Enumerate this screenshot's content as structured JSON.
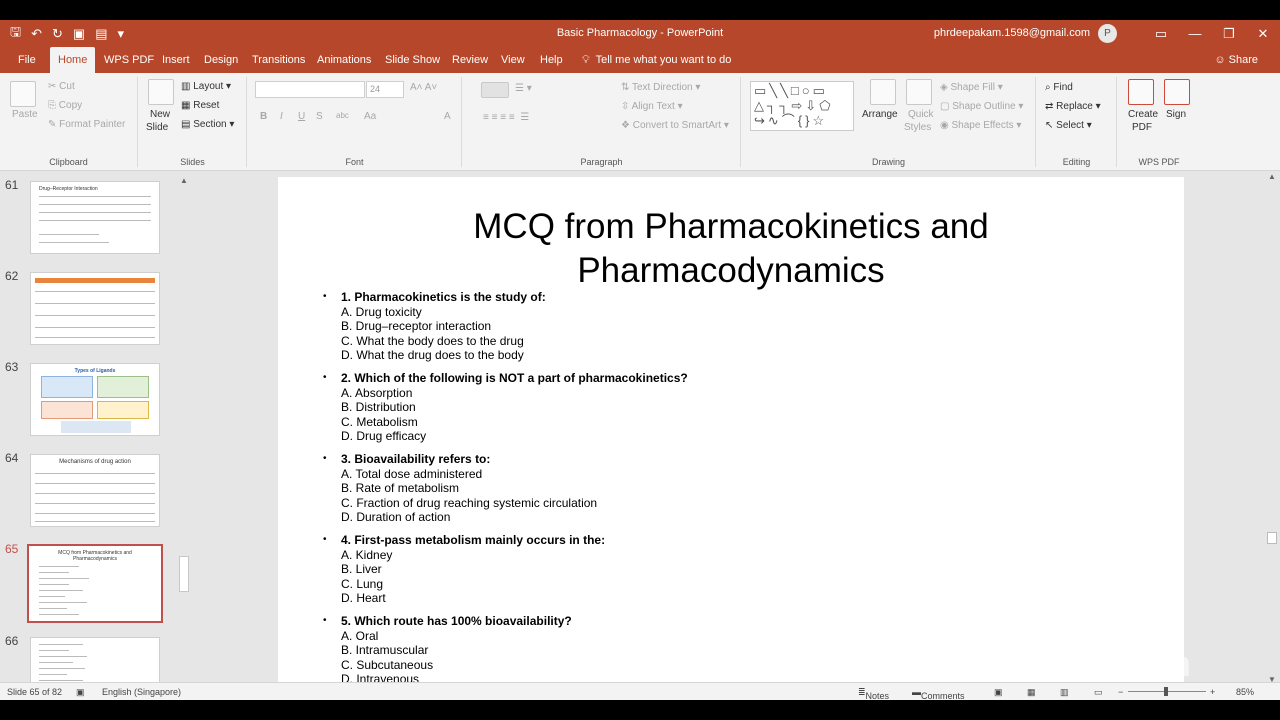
{
  "window": {
    "title": "Basic Pharmacology - PowerPoint",
    "account": "phrdeepakam.1598@gmail.com",
    "avatar_letter": "P"
  },
  "tabs": [
    "File",
    "Home",
    "WPS PDF",
    "Insert",
    "Design",
    "Transitions",
    "Animations",
    "Slide Show",
    "Review",
    "View",
    "Help"
  ],
  "tellme": "Tell me what you want to do",
  "share": "Share",
  "ribbon": {
    "clipboard": {
      "paste": "Paste",
      "cut": "Cut",
      "copy": "Copy",
      "format_painter": "Format Painter",
      "label": "Clipboard"
    },
    "slides": {
      "new_slide_1": "New",
      "new_slide_2": "Slide",
      "layout": "Layout",
      "reset": "Reset",
      "section": "Section",
      "label": "Slides"
    },
    "font": {
      "size": "24",
      "bold": "B",
      "italic": "I",
      "underline": "U",
      "strike": "S",
      "spacing": "abc",
      "case": "Aa",
      "label": "Font"
    },
    "paragraph": {
      "text_direction": "Text Direction",
      "align_text": "Align Text",
      "smartart": "Convert to SmartArt",
      "label": "Paragraph"
    },
    "drawing": {
      "arrange": "Arrange",
      "quick_styles_1": "Quick",
      "quick_styles_2": "Styles",
      "shape_fill": "Shape Fill",
      "shape_outline": "Shape Outline",
      "shape_effects": "Shape Effects",
      "label": "Drawing"
    },
    "editing": {
      "find": "Find",
      "replace": "Replace",
      "select": "Select",
      "label": "Editing"
    },
    "wps": {
      "create_1": "Create",
      "create_2": "PDF",
      "sign": "Sign",
      "label": "WPS PDF"
    }
  },
  "thumbnails": [
    {
      "num": "61",
      "title": "Drug–Receptor Interaction"
    },
    {
      "num": "62",
      "title": ""
    },
    {
      "num": "63",
      "title": "Types of Ligands"
    },
    {
      "num": "64",
      "title": "Mechanisms of drug action"
    },
    {
      "num": "65",
      "title": "MCQ from Pharmacokinetics and Pharmacodynamics"
    },
    {
      "num": "66",
      "title": ""
    }
  ],
  "slide": {
    "title": "MCQ from Pharmacokinetics and Pharmacodynamics",
    "questions": [
      {
        "q": "1. Pharmacokinetics is the study of:",
        "options": [
          "A. Drug toxicity",
          "B. Drug–receptor interaction",
          "C. What the body does to the drug",
          "D. What the drug does to the body"
        ]
      },
      {
        "q": "2. Which of the following is NOT a part of pharmacokinetics?",
        "options": [
          "A. Absorption",
          "B. Distribution",
          "C. Metabolism",
          "D. Drug efficacy"
        ]
      },
      {
        "q": "3. Bioavailability refers to:",
        "options": [
          "A. Total dose administered",
          "B. Rate of metabolism",
          "C. Fraction of drug reaching systemic circulation",
          "D. Duration of action"
        ]
      },
      {
        "q": "4. First-pass metabolism mainly occurs in the:",
        "options": [
          "A. Kidney",
          "B. Liver",
          "C. Lung",
          "D. Heart"
        ]
      },
      {
        "q": "5. Which route has 100% bioavailability?",
        "options": [
          "A. Oral",
          "B. Intramuscular",
          "C. Subcutaneous",
          "D. Intravenous"
        ]
      }
    ]
  },
  "status": {
    "slide_info": "Slide 65 of 82",
    "language": "English (Singapore)",
    "notes": "Notes",
    "comments": "Comments",
    "zoom": "85%"
  },
  "watermark": "zoom"
}
